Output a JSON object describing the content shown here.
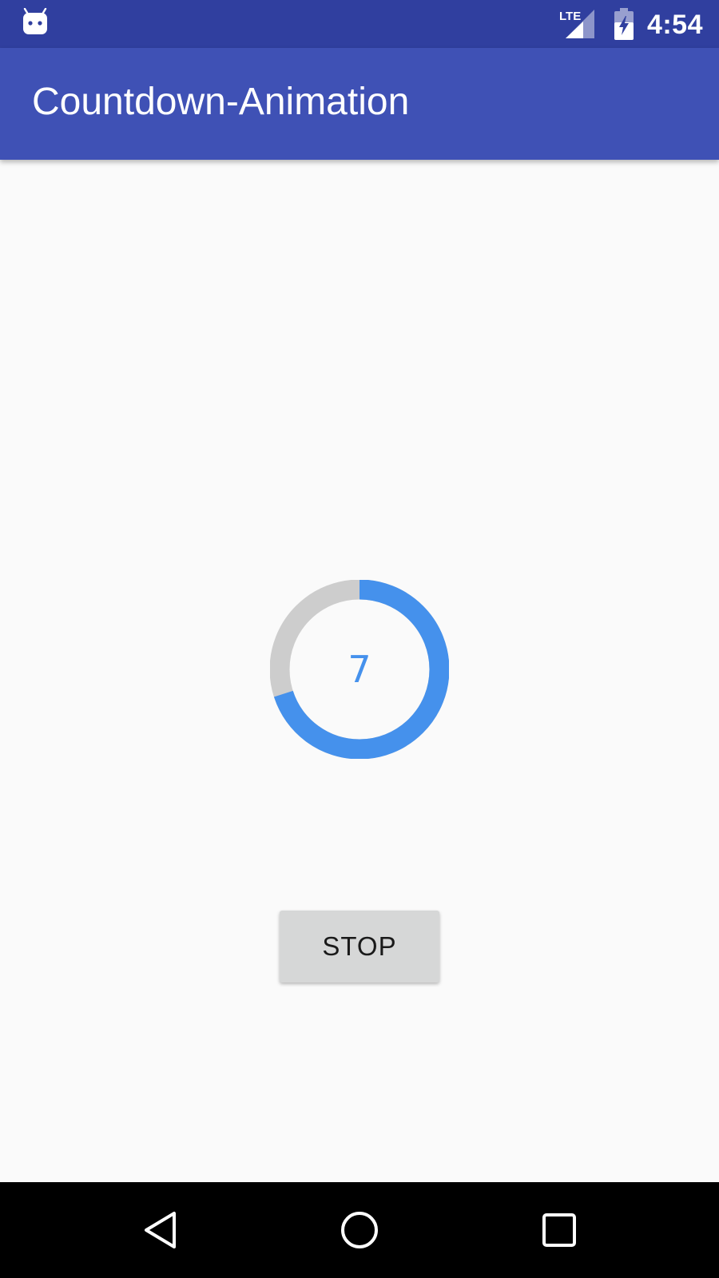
{
  "status_bar": {
    "time": "4:54",
    "network_label": "LTE",
    "icons": [
      "android-notification-icon",
      "lte-signal-icon",
      "battery-charging-icon"
    ]
  },
  "app_bar": {
    "title": "Countdown-Animation"
  },
  "countdown": {
    "value": "7",
    "progress_fraction": 0.7,
    "colors": {
      "progress": "#4591ec",
      "track": "#cdcdcd",
      "number": "#4591ec"
    }
  },
  "controls": {
    "stop_label": "STOP"
  },
  "nav_bar": {
    "icons": [
      "back-icon",
      "home-icon",
      "recents-icon"
    ]
  },
  "colors": {
    "status_bar": "#303f9f",
    "app_bar": "#3f51b5",
    "background": "#fafafa"
  }
}
